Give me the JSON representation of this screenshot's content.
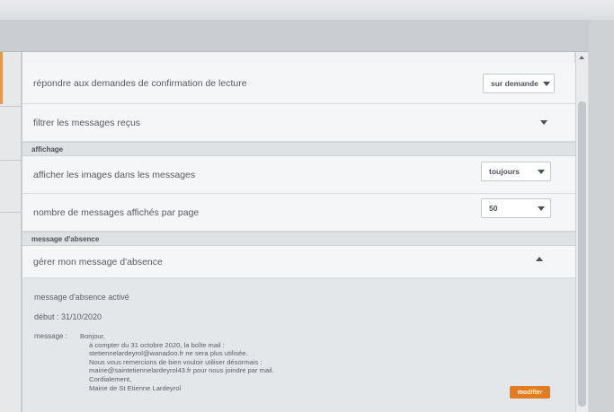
{
  "settings": {
    "read_receipt": {
      "label": "répondre aux demandes de confirmation de lecture",
      "value": "sur demande"
    },
    "filter": {
      "label": "filtrer les messages reçus"
    },
    "display_section": "affichage",
    "images": {
      "label": "afficher les images dans les messages",
      "value": "toujours"
    },
    "per_page": {
      "label": "nombre de messages affichés par page",
      "value": "50"
    },
    "absence_section": "message d'absence",
    "absence_manage": {
      "label": "gérer mon message d'absence"
    }
  },
  "absence": {
    "status": "message d'absence activé",
    "start": "début : 31/10/2020",
    "message_label": "message :",
    "message_lines": [
      "Bonjour,",
      "à compter du 31 octobre 2020, la boîte mail :",
      "stetiennelardeyrol@wanadoo.fr ne sera plus utilisée.",
      "Nous vous remercions de bien vouloir utiliser désormais :",
      "mairie@saintetiennelardeyrol43.fr pour nous joindre par mail.",
      "Cordialement,",
      "Mairie de St Etienne Lardeyrol"
    ],
    "modify_label": "modifier"
  },
  "colors": {
    "accent": "#e27c22",
    "panel": "#f5f6f7",
    "section": "#dfe2e5"
  }
}
